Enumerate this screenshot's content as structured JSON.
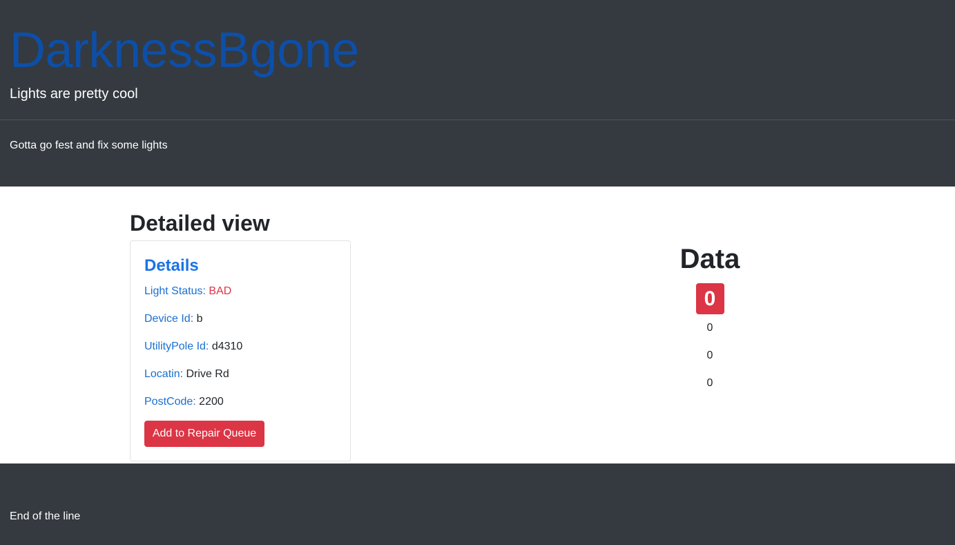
{
  "header": {
    "brand": "DarknessBgone",
    "tagline": "Lights are pretty cool",
    "lead": "Gotta go fest and fix some lights"
  },
  "main": {
    "section_title": "Detailed view",
    "card": {
      "title": "Details",
      "rows": [
        {
          "label": "Light Status:",
          "value": "BAD"
        },
        {
          "label": "Device Id:",
          "value": "b"
        },
        {
          "label": "UtilityPole Id:",
          "value": "d4310"
        },
        {
          "label": "Locatin:",
          "value": "Drive Rd"
        },
        {
          "label": "PostCode:",
          "value": "2200"
        }
      ],
      "button_label": "Add to Repair Queue"
    },
    "data_panel": {
      "title": "Data",
      "badge_value": "0",
      "values": [
        "0",
        "0",
        "0"
      ]
    }
  },
  "footer": {
    "text": "End of the line"
  },
  "colors": {
    "header_bg": "#343a40",
    "brand": "#0d4fa8",
    "link_blue": "#1a73e8",
    "danger": "#dc3545"
  }
}
